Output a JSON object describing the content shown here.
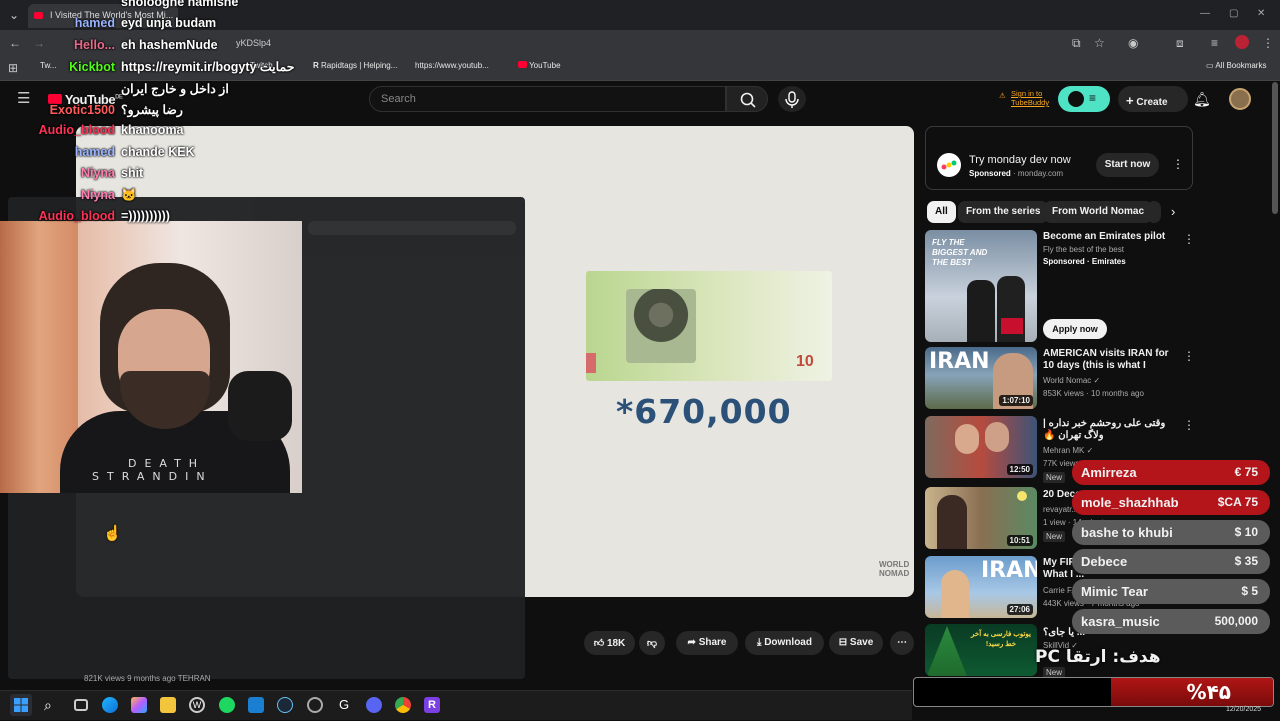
{
  "browser": {
    "tab_title": "I Visited The World's Most Mi...",
    "url_fragment": "yKDSlp4",
    "bookmarks": [
      "Tw...",
      "Kickbot...",
      "Twitch",
      "Rapidtags | Helping...",
      "https://www.youtub...",
      "YouTube"
    ],
    "all_bookmarks": "All Bookmarks"
  },
  "youtube": {
    "logo": "YouTube",
    "logo_suffix": "DE",
    "search_placeholder": "Search",
    "tubebuddy_line1": "Sign in to",
    "tubebuddy_line2": "TubeBuddy",
    "create_label": "Create"
  },
  "video": {
    "price_text": "*670,000",
    "note_value": "10",
    "watermark": "WORLD NOMAD",
    "likes": "18K",
    "share_label": "Share",
    "download_label": "Download",
    "save_label": "Save",
    "meta": "821K views  9 months ago  TEHRAN"
  },
  "webcam": {
    "shirt_line1": "DEATH",
    "shirt_line2": "STRANDIN"
  },
  "chat": [
    {
      "name": "",
      "msg": "sholooghe namishe",
      "color": "#ffffff"
    },
    {
      "name": "hamed",
      "msg": "eyd unja budam",
      "color": "#9ab4ff"
    },
    {
      "name": "Hello...",
      "msg": "eh hashemNude",
      "color": "#e86a8a"
    },
    {
      "name": "Kickbot",
      "msg": "https://reymit.ir/bogyty حمایت",
      "color": "#53fc18"
    },
    {
      "name": "",
      "msg": "از داخل و خارج ایران",
      "color": "#ffffff"
    },
    {
      "name": "Exotic1500",
      "msg": "رضا پیشرو؟",
      "color": "#ff5c5c"
    },
    {
      "name": "Audio_blood",
      "msg": "khanooma",
      "color": "#ff3355"
    },
    {
      "name": "hamed",
      "msg": "chande KEK",
      "color": "#9ab4ff"
    },
    {
      "name": "Niyna",
      "msg": "shit",
      "color": "#ff7eb0"
    },
    {
      "name": "Niyna",
      "msg": "🐱",
      "color": "#ff7eb0"
    },
    {
      "name": "Audio_blood",
      "msg": "=))))))))))",
      "color": "#ff3355"
    }
  ],
  "ad": {
    "title": "Try monday dev now",
    "sponsored": "Sponsored",
    "domain": "monday.com",
    "cta": "Start now"
  },
  "chips": [
    "All",
    "From the series",
    "From World Nomac"
  ],
  "recommendations": [
    {
      "title": "Become an Emirates pilot",
      "sub1": "Fly the best of the best",
      "sub2": "Sponsored · Emirates",
      "cta": "Apply now",
      "duration": "",
      "thumb_text": "FLY THE BIGGEST AND THE BEST"
    },
    {
      "title": "AMERICAN visits IRAN for 10 days (this is what I found) 🇮🇷",
      "sub1": "World Nomac ✓",
      "sub2": "853K views · 10 months ago",
      "duration": "1:07:10",
      "thumb_text": "IRAN"
    },
    {
      "title": "وقتی علی روحشم خبر نداره | ولاگ تهران 🔥",
      "sub1": "Mehran MK ✓",
      "sub2": "77K views",
      "badge": "New",
      "duration": "12:50",
      "thumb_text": ""
    },
    {
      "title": "20 Dece...",
      "sub1": "revayatr...",
      "sub2": "1 view · 14 minutes ago",
      "badge": "New",
      "duration": "10:51",
      "thumb_text": ""
    },
    {
      "title": "My FIR... SHOCKED by What I ...",
      "sub1": "Carrie F...",
      "sub2": "443K views · 7 months ago",
      "duration": "27:06",
      "thumb_text": "IRAN"
    },
    {
      "title": "... یا جای؟",
      "sub1": "SkillVid ✓",
      "sub2": "",
      "badge": "New",
      "duration": "",
      "thumb_text": "یوتوب فارسی به آخر خط رسید!"
    }
  ],
  "donations": [
    {
      "name": "Amirreza",
      "amount": "€ 75",
      "bg": "#b3151b"
    },
    {
      "name": "mole_shazhhab",
      "amount": "$CA 75",
      "bg": "#b3151b"
    },
    {
      "name": "bashe to khubi",
      "amount": "$ 10",
      "bg": "#5b5b5b"
    },
    {
      "name": "Debece",
      "amount": "$ 35",
      "bg": "#5b5b5b"
    },
    {
      "name": "Mimic Tear",
      "amount": "$ 5",
      "bg": "#5b5b5b"
    },
    {
      "name": "kasra_music",
      "amount": "500,000",
      "bg": "#5b5b5b"
    }
  ],
  "goal": {
    "title": "هدف: ارتقا PC",
    "percent_label": "%۴۵",
    "progress": 0.45
  },
  "taskbar": {
    "date": "12/20/2025",
    "icons": [
      "windows-icon",
      "search-icon",
      "taskview-icon",
      "edge-icon",
      "copilot-icon",
      "explorer-icon",
      "word-icon",
      "spotify-icon",
      "vscode-icon",
      "steam-icon",
      "app-icon",
      "github-icon",
      "discord-icon",
      "chrome-icon",
      "rider-icon"
    ]
  }
}
